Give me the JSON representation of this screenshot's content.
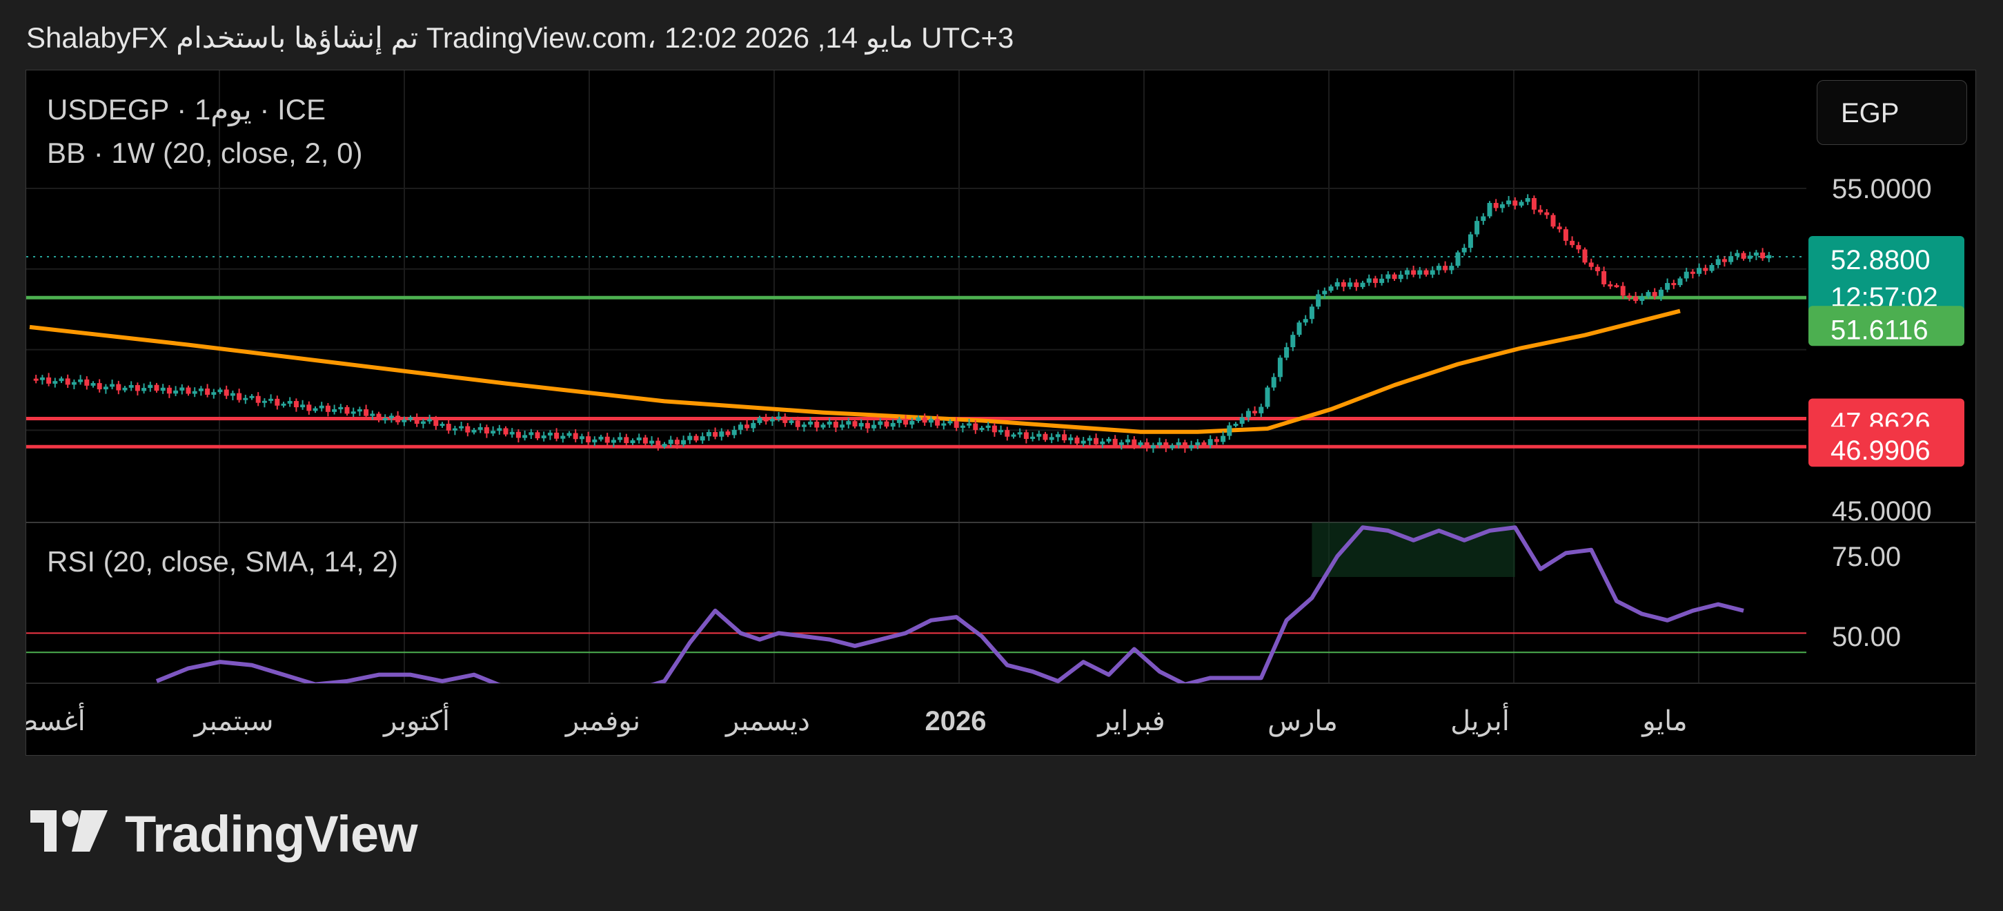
{
  "header": {
    "text": "ShalabyFX تم إنشاؤها باستخدام TradingView.com، 12:02 2026 ,14 مايو UTC+3"
  },
  "legend": {
    "symbol_line": "USDEGP · 1يوم · ICE",
    "bb_line": "BB · 1W (20, close, 2, 0)",
    "rsi_line": "RSI (20, close, SMA, 14, 2)"
  },
  "currency_button": "EGP",
  "price_axis": {
    "ticks": [
      "55.0000",
      "45.0000"
    ]
  },
  "rsi_axis": {
    "ticks": [
      "75.00",
      "50.00"
    ]
  },
  "time_axis": {
    "labels": [
      "أغسطس",
      "سبتمبر",
      "أكتوبر",
      "نوفمبر",
      "ديسمبر",
      "2026",
      "فبراير",
      "مارس",
      "أبريل",
      "مايو"
    ]
  },
  "price_tags": {
    "last_price": "52.8800",
    "countdown": "12:57:02",
    "green_line": "51.6116",
    "red_line_1": "47.8626",
    "red_line_2": "46.9906"
  },
  "colors": {
    "up": "#26a69a",
    "down": "#f23645",
    "bb_basis": "#ff9800",
    "rsi": "#7e57c2",
    "level_green": "#4caf50",
    "level_red": "#f23645",
    "tag_teal": "#089981",
    "tag_green": "#4caf50",
    "tag_red": "#f23645"
  },
  "brand": {
    "name": "TradingView"
  },
  "chart_data": [
    {
      "type": "line",
      "title": "USDEGP · 1يوم · ICE",
      "x_axis": "time (daily), Aug 2025 – May 2026",
      "ylim": [
        45,
        56
      ],
      "horizontal_levels": [
        51.6116,
        47.8626,
        46.9906
      ],
      "last_price": 52.88,
      "close_series": {
        "name": "USDEGP",
        "x_index": [
          0,
          8,
          16,
          24,
          32,
          40,
          48,
          56,
          62,
          68,
          76,
          84,
          92,
          100,
          108,
          116,
          122,
          128,
          134,
          142,
          150,
          158,
          166,
          172,
          178,
          184,
          188,
          190,
          194,
          198,
          204,
          210,
          216,
          224,
          230,
          236,
          242,
          248,
          252,
          256,
          262,
          268,
          274
        ],
        "values": [
          49.1,
          48.95,
          48.8,
          48.75,
          48.6,
          48.3,
          48.15,
          47.9,
          47.75,
          47.55,
          47.4,
          47.3,
          47.2,
          47.1,
          47.35,
          47.85,
          47.7,
          47.65,
          47.7,
          47.8,
          47.55,
          47.3,
          47.2,
          47.1,
          47.05,
          47.0,
          47.35,
          47.8,
          48.2,
          50.2,
          51.9,
          52.1,
          52.3,
          52.6,
          54.5,
          54.6,
          53.5,
          52.1,
          51.6,
          51.75,
          52.4,
          52.9,
          52.88
        ]
      },
      "indicator": {
        "name": "BB · 1W (20, close, 2, 0)",
        "x_index": [
          0,
          25,
          50,
          75,
          100,
          125,
          150,
          175,
          184,
          195,
          205,
          215,
          225,
          235,
          245,
          255,
          260
        ],
        "values": [
          50.7,
          50.15,
          49.55,
          48.95,
          48.4,
          48.05,
          47.8,
          47.45,
          47.45,
          47.55,
          48.15,
          48.9,
          49.55,
          50.05,
          50.45,
          50.95,
          51.2
        ]
      }
    },
    {
      "type": "line",
      "title": "RSI (20, close, SMA, 14, 2)",
      "ylim": [
        35,
        85
      ],
      "levels": [
        51,
        45
      ],
      "series": [
        {
          "name": "RSI",
          "x_index": [
            20,
            25,
            30,
            35,
            40,
            45,
            50,
            55,
            60,
            65,
            70,
            75,
            80,
            90,
            100,
            104,
            108,
            112,
            115,
            118,
            122,
            126,
            130,
            134,
            138,
            142,
            146,
            150,
            154,
            158,
            162,
            166,
            170,
            174,
            178,
            182,
            186,
            190,
            194,
            198,
            202,
            206,
            210,
            214,
            218,
            222,
            226,
            230,
            234,
            238,
            242,
            246,
            250,
            254,
            258,
            262,
            266,
            270
          ],
          "values": [
            36,
            40,
            42,
            41,
            38,
            35,
            36,
            38,
            38,
            36,
            38,
            34,
            30,
            30,
            36,
            48,
            58,
            51,
            49,
            51,
            50,
            49,
            47,
            49,
            51,
            55,
            56,
            50,
            41,
            39,
            36,
            42,
            38,
            46,
            39,
            35,
            37,
            37,
            37,
            55,
            62,
            75,
            84,
            83,
            80,
            83,
            80,
            83,
            84,
            71,
            76,
            77,
            61,
            57,
            55,
            58,
            60,
            58
          ]
        }
      ]
    }
  ]
}
